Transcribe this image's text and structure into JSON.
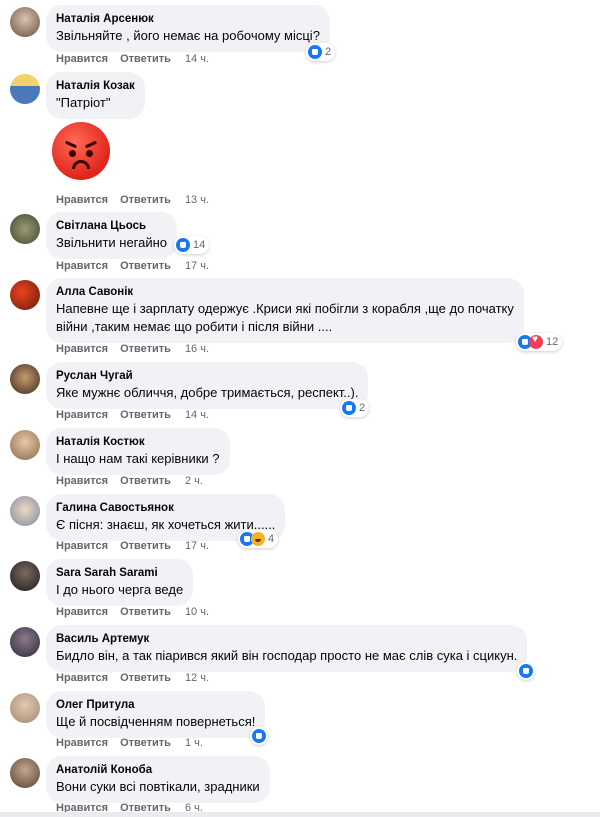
{
  "labels": {
    "like": "Нравится",
    "reply": "Ответить"
  },
  "comments": [
    {
      "author": "Наталія Арсенюк",
      "text": "Звільняйте , його немає на робочому місці?",
      "time": "14 ч.",
      "reactions": "2"
    },
    {
      "author": "Наталія Козак",
      "text": "\"Патріот\"",
      "time": "13 ч.",
      "sticker": "angry-face"
    },
    {
      "author": "Світлана Цьось",
      "text": "Звільнити негайно",
      "time": "17 ч.",
      "reactions": "14"
    },
    {
      "author": "Алла Савонік",
      "text": "Напевне ще і зарплату одержує .Криси які побігли з корабля ,ще до початку",
      "text2": "війни ,таким немає що робити і після війни ....",
      "time": "16 ч.",
      "reactions": "12"
    },
    {
      "author": "Руслан Чугай",
      "text": "Яке мужнє обличчя, добре тримається, респект..).",
      "time": "14 ч.",
      "reactions": "2"
    },
    {
      "author": "Наталія Костюк",
      "text": "І нащо нам такі керівники ?",
      "time": "2 ч."
    },
    {
      "author": "Галина Савостьянок",
      "text": "Є пісня: знаєш, як хочеться жити......",
      "time": "17 ч.",
      "reactions": "4"
    },
    {
      "author": "Sara Sarah Sarami",
      "text": "І до нього черга веде",
      "time": "10 ч."
    },
    {
      "author": "Василь Артемук",
      "text": "Бидло він, а так піарився який він господар просто не має слів сука і сцикун.",
      "time": "12 ч."
    },
    {
      "author": "Олег Притула",
      "text": "Ще й посвідченням повернеться!",
      "time": "1 ч."
    },
    {
      "author": "Анатолій Коноба",
      "text": "Вони суки всі повтікали, зрадники",
      "time": "6 ч."
    }
  ],
  "colors": {
    "like": "#1877f2",
    "love": "#f33e58",
    "haha": "#f7b125",
    "bubble": "#f0f2f5",
    "meta": "#65676b"
  }
}
